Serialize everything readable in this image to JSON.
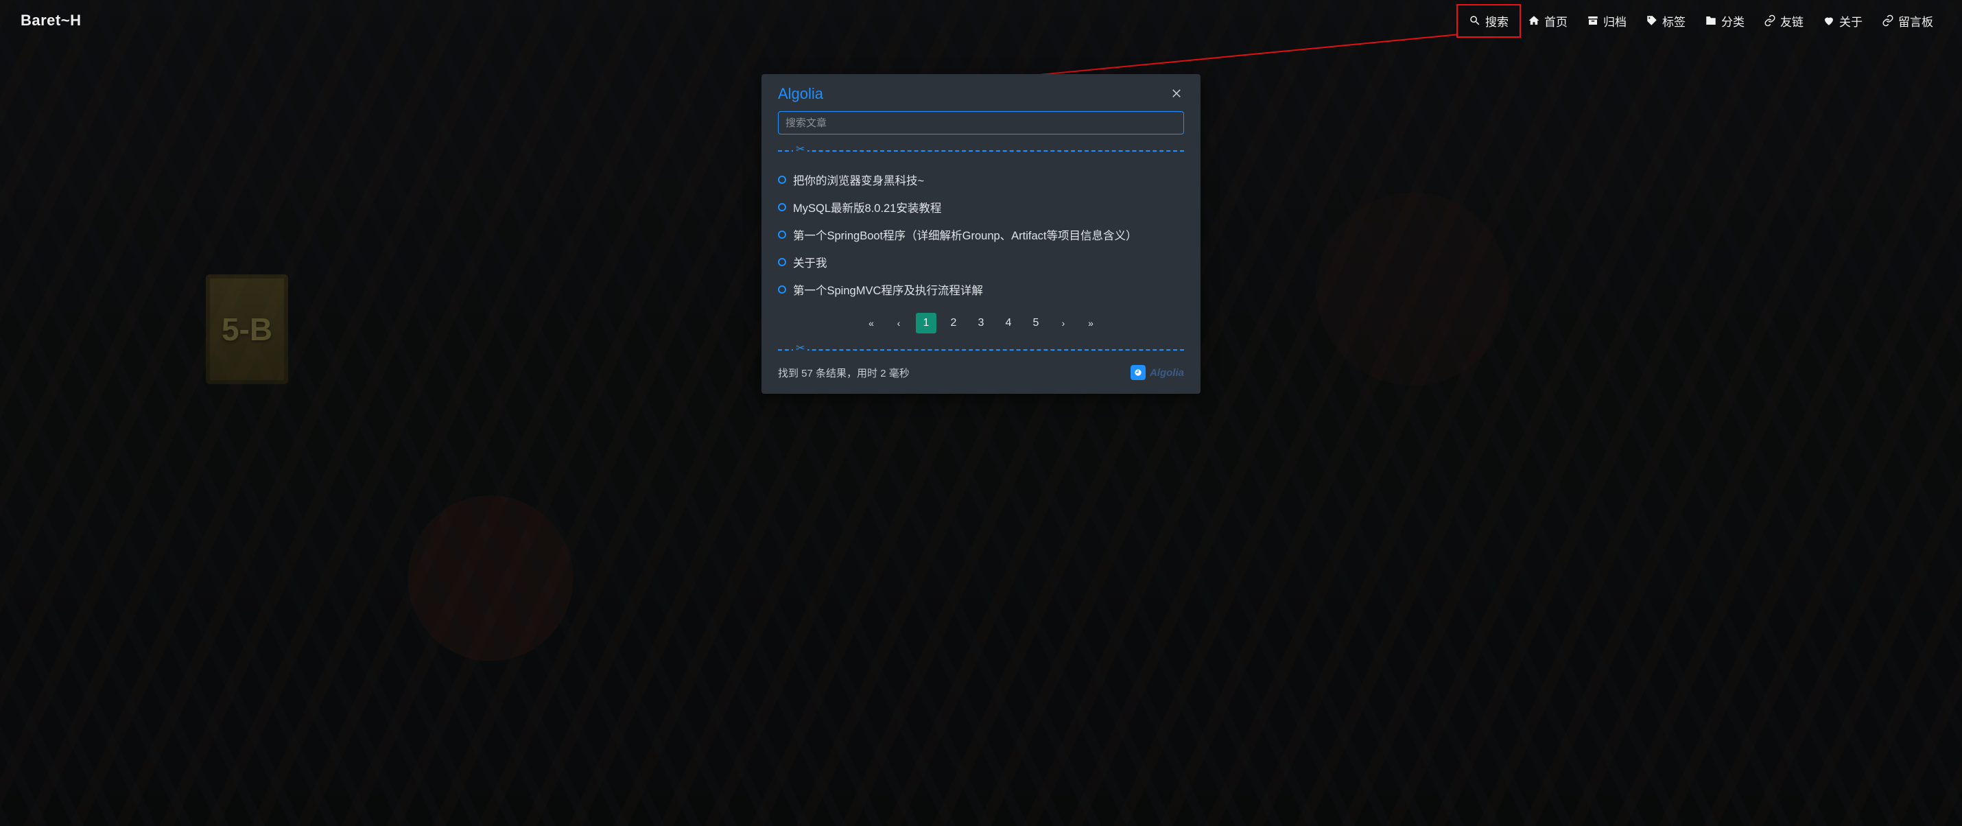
{
  "colors": {
    "accent": "#1e90ff",
    "highlight": "#e11111",
    "active_page_bg": "#128f76"
  },
  "brand": "Baret~H",
  "nav": {
    "items": [
      {
        "icon": "search",
        "label": "搜索"
      },
      {
        "icon": "home",
        "label": "首页"
      },
      {
        "icon": "archive",
        "label": "归档"
      },
      {
        "icon": "tags",
        "label": "标签"
      },
      {
        "icon": "folder",
        "label": "分类"
      },
      {
        "icon": "link",
        "label": "友链"
      },
      {
        "icon": "heart",
        "label": "关于"
      },
      {
        "icon": "link",
        "label": "留言板"
      }
    ]
  },
  "decor": {
    "sign_text": "5-B"
  },
  "modal": {
    "title": "Algolia",
    "search_placeholder": "搜索文章",
    "search_value": "",
    "results": [
      "把你的浏览器变身黑科技~",
      "MySQL最新版8.0.21安装教程",
      "第一个SpringBoot程序（详细解析Grounp、Artifact等项目信息含义）",
      "关于我",
      "第一个SpingMVC程序及执行流程详解"
    ],
    "pagination": {
      "pages": [
        "1",
        "2",
        "3",
        "4",
        "5"
      ],
      "active_index": 0
    },
    "footer_stats": "找到 57 条结果，用时 2 毫秒",
    "badge_text": "Algolia"
  }
}
